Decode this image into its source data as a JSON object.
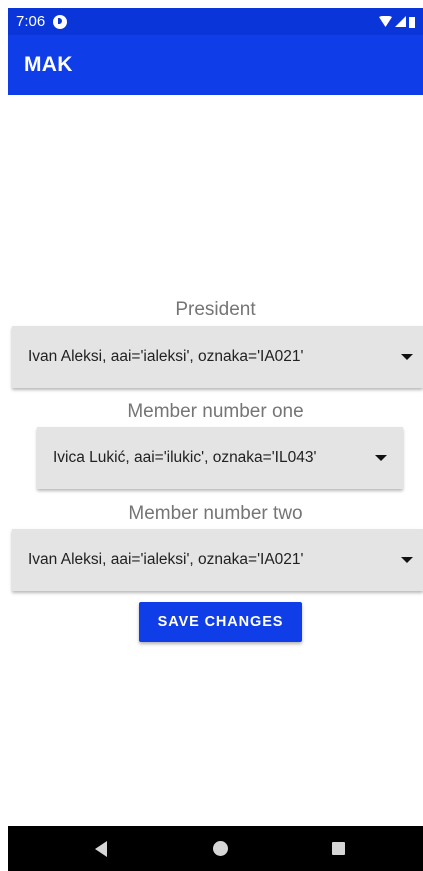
{
  "status_bar": {
    "time": "7:06",
    "app_icon": "app-notification-icon",
    "icons": [
      "wifi-icon",
      "signal-icon",
      "battery-icon"
    ]
  },
  "app_bar": {
    "title": "MAK"
  },
  "form": {
    "president": {
      "label": "President",
      "selected": "Ivan Aleksi, aai='ialeksi', oznaka='IA021'"
    },
    "member_one": {
      "label": "Member number one",
      "selected": "Ivica Lukić, aai='ilukic', oznaka='IL043'"
    },
    "member_two": {
      "label": "Member number two",
      "selected": "Ivan Aleksi, aai='ialeksi', oznaka='IA021'"
    },
    "save_label": "Save changes"
  },
  "nav_bar": {
    "icons": [
      "back-icon",
      "home-icon",
      "recents-icon"
    ]
  },
  "colors": {
    "primary": "#0f3ee9",
    "status_bar": "#0a36d9",
    "spinner_bg": "#e4e4e4",
    "label_text": "#757575"
  }
}
